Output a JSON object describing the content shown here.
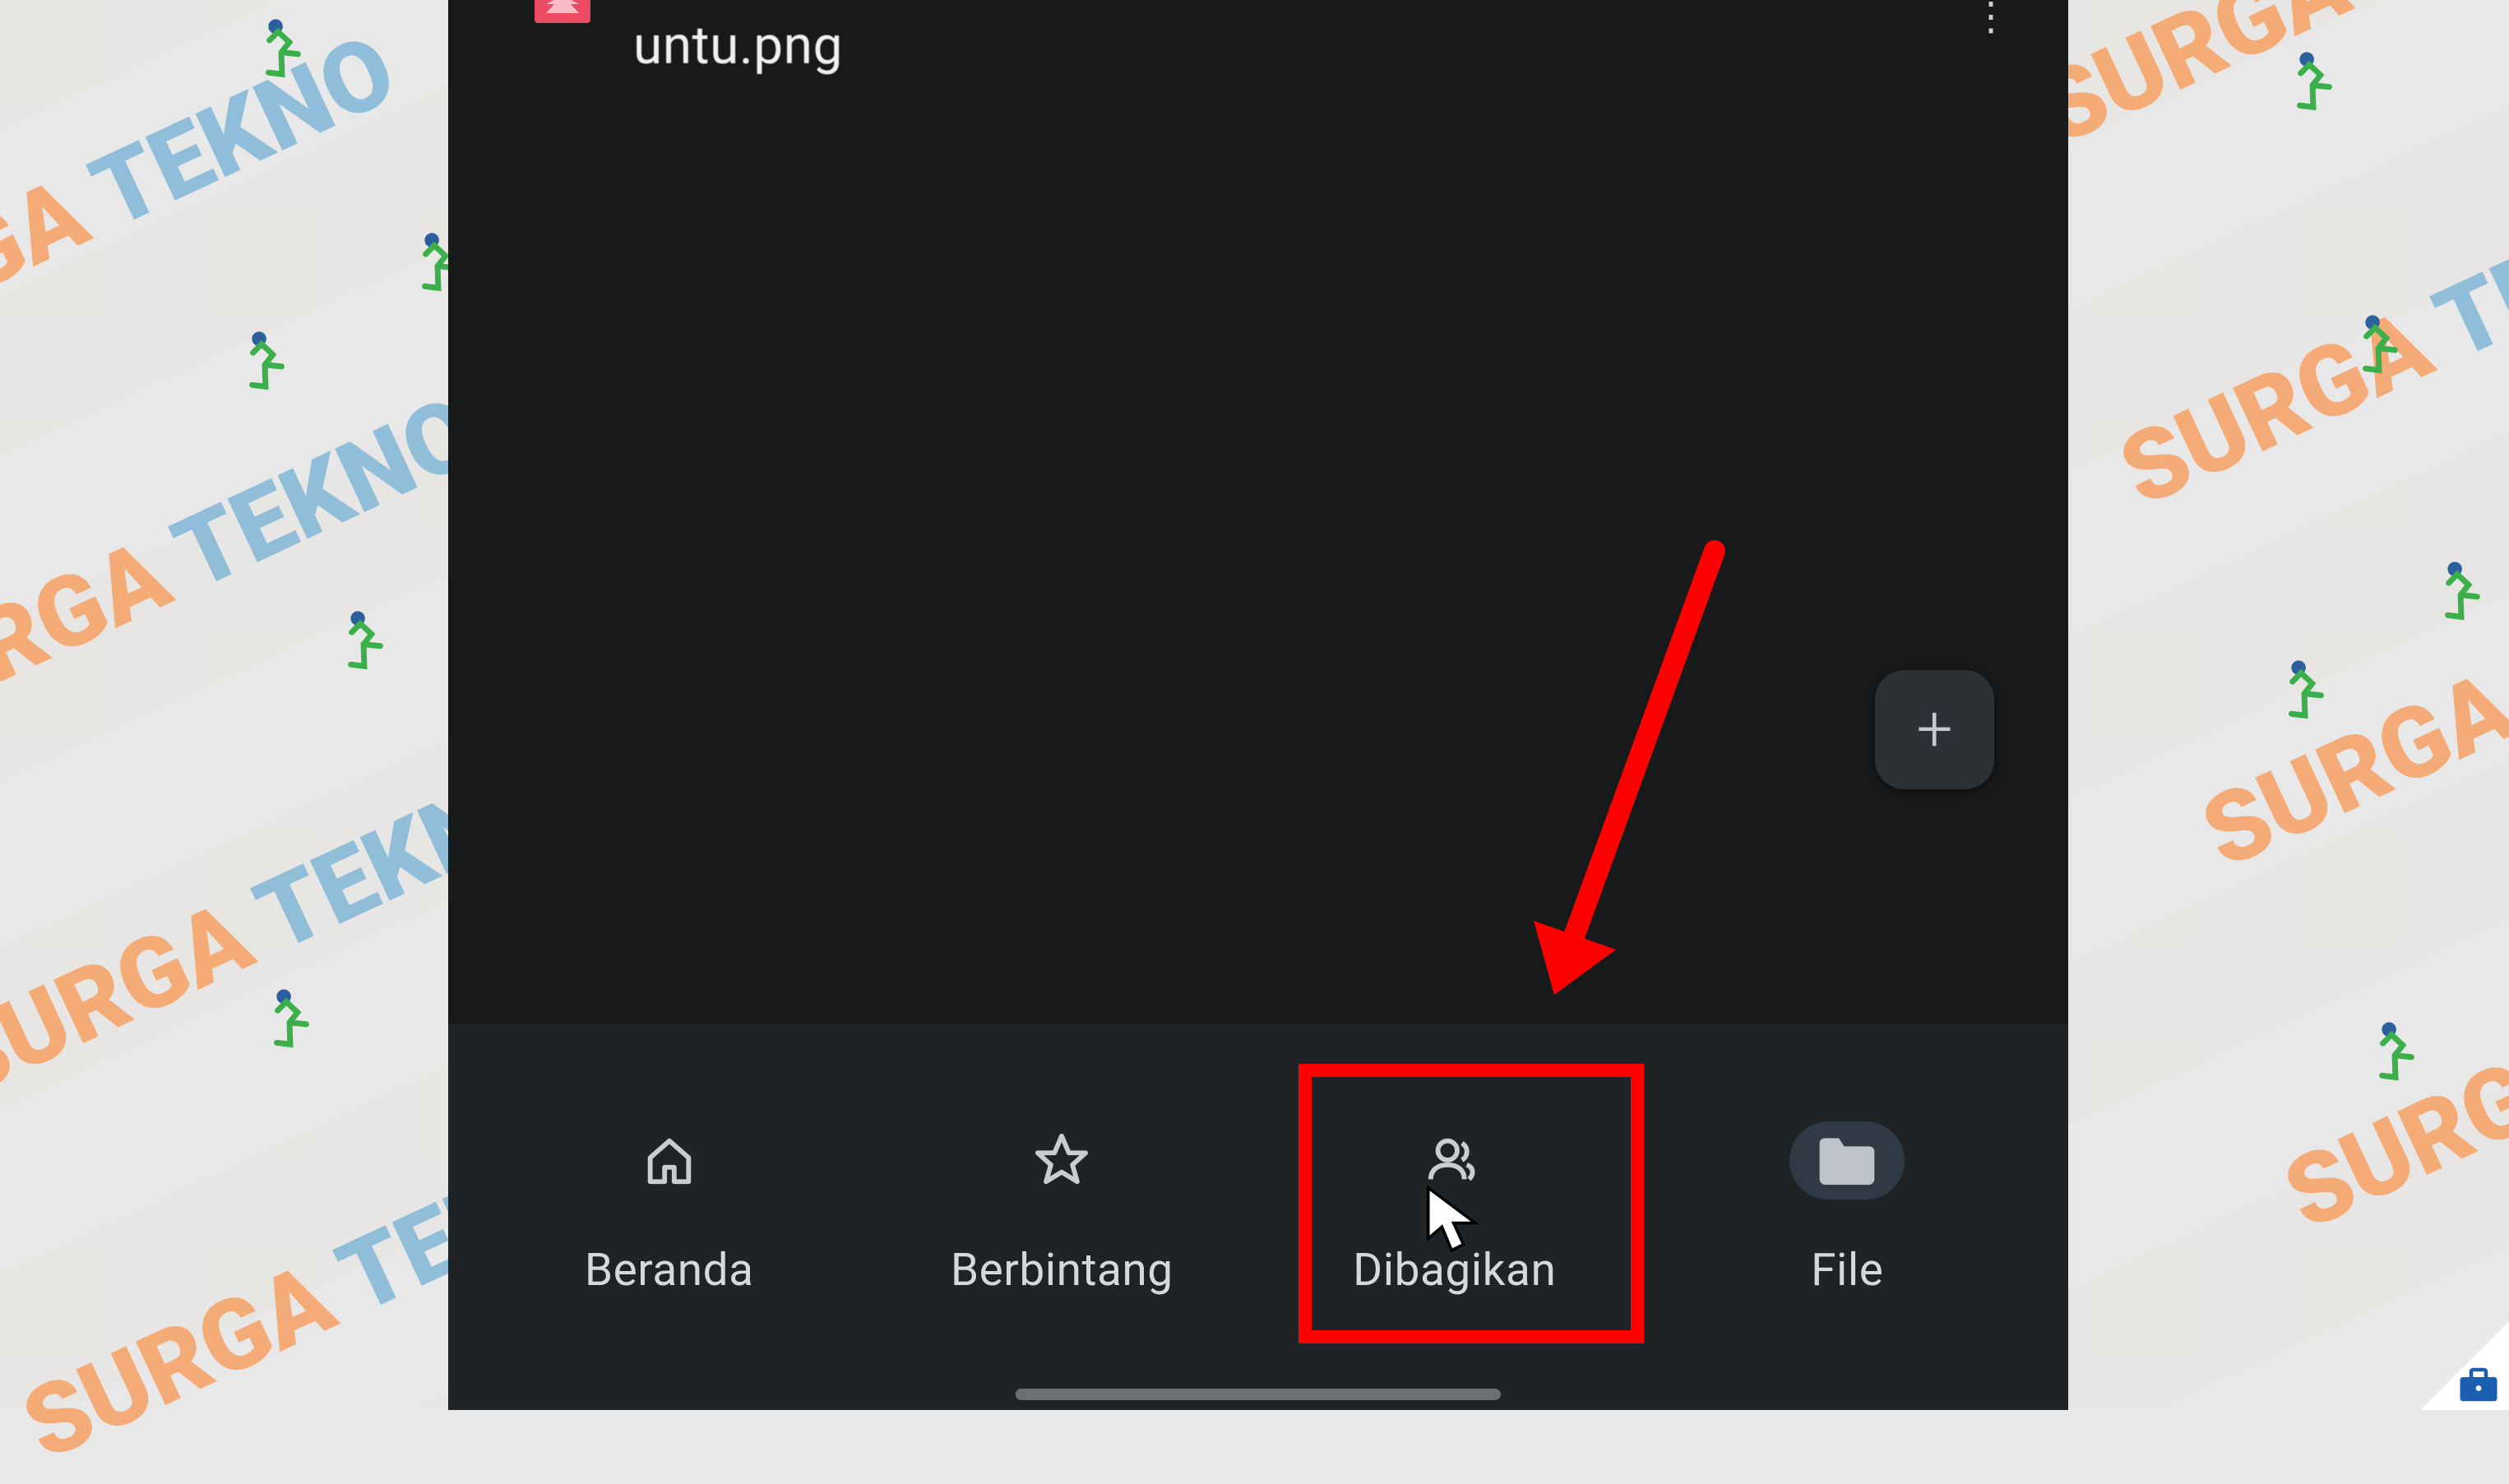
{
  "file": {
    "name": "untu.png",
    "thumb_type": "image"
  },
  "fab": {
    "glyph": "+"
  },
  "nav": {
    "items": [
      {
        "label": "Beranda",
        "icon": "home-icon",
        "active": false
      },
      {
        "label": "Berbintang",
        "icon": "star-icon",
        "active": false
      },
      {
        "label": "Dibagikan",
        "icon": "people-icon",
        "active": false,
        "highlighted": true
      },
      {
        "label": "File",
        "icon": "folder-icon",
        "active": true
      }
    ]
  },
  "annotations": {
    "arrow_color": "#ff0000",
    "highlight_color": "#ff0000"
  },
  "watermark": {
    "text_part1": "SURGA",
    "text_part2": "TEKNO"
  }
}
